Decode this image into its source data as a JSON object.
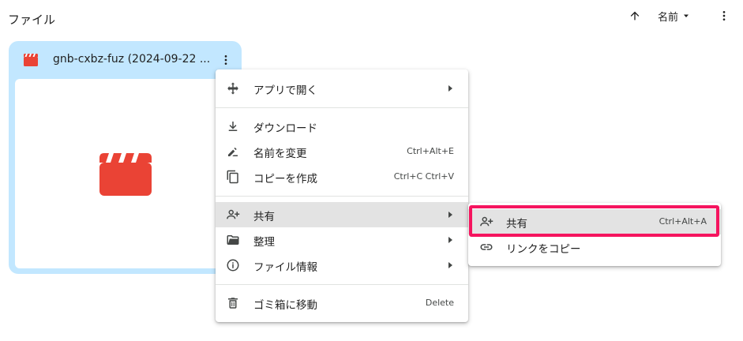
{
  "section": {
    "title": "ファイル"
  },
  "toolbar": {
    "sort_label": "名前",
    "sort_direction_icon": "arrow-up-icon"
  },
  "file": {
    "name": "gnb-cxbz-fuz (2024-09-22 ...",
    "icon": "video-file-icon",
    "icon_color": "#ea4335",
    "card_color": "#c2e7ff"
  },
  "context_menu": {
    "open_with": {
      "label": "アプリで開く"
    },
    "download": {
      "label": "ダウンロード"
    },
    "rename": {
      "label": "名前を変更",
      "shortcut": "Ctrl+Alt+E"
    },
    "copy": {
      "label": "コピーを作成",
      "shortcut": "Ctrl+C Ctrl+V"
    },
    "share": {
      "label": "共有"
    },
    "organize": {
      "label": "整理"
    },
    "file_info": {
      "label": "ファイル情報"
    },
    "trash": {
      "label": "ゴミ箱に移動",
      "shortcut": "Delete"
    }
  },
  "share_submenu": {
    "share": {
      "label": "共有",
      "shortcut": "Ctrl+Alt+A"
    },
    "copy_link": {
      "label": "リンクをコピー"
    }
  },
  "colors": {
    "hover": "#e3e3e3",
    "highlight_border": "#f5145e",
    "text": "#1f1f1f"
  }
}
